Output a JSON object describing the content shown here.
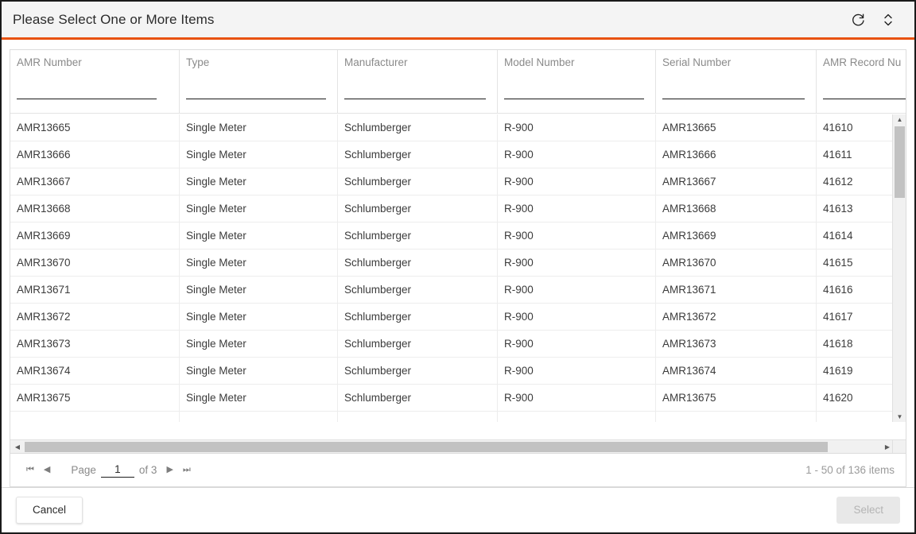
{
  "dialog": {
    "title": "Please Select One or More Items",
    "accent_color": "#e8520f",
    "refresh_icon": "refresh-icon",
    "expand_icon": "expand-collapse-icon"
  },
  "grid": {
    "columns": [
      {
        "label": "AMR Number",
        "filter_value": ""
      },
      {
        "label": "Type",
        "filter_value": ""
      },
      {
        "label": "Manufacturer",
        "filter_value": ""
      },
      {
        "label": "Model Number",
        "filter_value": ""
      },
      {
        "label": "Serial Number",
        "filter_value": ""
      },
      {
        "label": "AMR Record Nu",
        "filter_value": ""
      }
    ],
    "rows": [
      {
        "amr_number": "AMR13665",
        "type": "Single Meter",
        "manufacturer": "Schlumberger",
        "model_number": "R-900",
        "serial_number": "AMR13665",
        "amr_record_number": "41610"
      },
      {
        "amr_number": "AMR13666",
        "type": "Single Meter",
        "manufacturer": "Schlumberger",
        "model_number": "R-900",
        "serial_number": "AMR13666",
        "amr_record_number": "41611"
      },
      {
        "amr_number": "AMR13667",
        "type": "Single Meter",
        "manufacturer": "Schlumberger",
        "model_number": "R-900",
        "serial_number": "AMR13667",
        "amr_record_number": "41612"
      },
      {
        "amr_number": "AMR13668",
        "type": "Single Meter",
        "manufacturer": "Schlumberger",
        "model_number": "R-900",
        "serial_number": "AMR13668",
        "amr_record_number": "41613"
      },
      {
        "amr_number": "AMR13669",
        "type": "Single Meter",
        "manufacturer": "Schlumberger",
        "model_number": "R-900",
        "serial_number": "AMR13669",
        "amr_record_number": "41614"
      },
      {
        "amr_number": "AMR13670",
        "type": "Single Meter",
        "manufacturer": "Schlumberger",
        "model_number": "R-900",
        "serial_number": "AMR13670",
        "amr_record_number": "41615"
      },
      {
        "amr_number": "AMR13671",
        "type": "Single Meter",
        "manufacturer": "Schlumberger",
        "model_number": "R-900",
        "serial_number": "AMR13671",
        "amr_record_number": "41616"
      },
      {
        "amr_number": "AMR13672",
        "type": "Single Meter",
        "manufacturer": "Schlumberger",
        "model_number": "R-900",
        "serial_number": "AMR13672",
        "amr_record_number": "41617"
      },
      {
        "amr_number": "AMR13673",
        "type": "Single Meter",
        "manufacturer": "Schlumberger",
        "model_number": "R-900",
        "serial_number": "AMR13673",
        "amr_record_number": "41618"
      },
      {
        "amr_number": "AMR13674",
        "type": "Single Meter",
        "manufacturer": "Schlumberger",
        "model_number": "R-900",
        "serial_number": "AMR13674",
        "amr_record_number": "41619"
      },
      {
        "amr_number": "AMR13675",
        "type": "Single Meter",
        "manufacturer": "Schlumberger",
        "model_number": "R-900",
        "serial_number": "AMR13675",
        "amr_record_number": "41620"
      },
      {
        "amr_number": "",
        "type": "",
        "manufacturer": "",
        "model_number": "",
        "serial_number": "",
        "amr_record_number": ""
      }
    ]
  },
  "pager": {
    "first_icon": "first-page-icon",
    "prev_icon": "previous-page-icon",
    "next_icon": "next-page-icon",
    "last_icon": "last-page-icon",
    "page_label": "Page",
    "page_value": "1",
    "of_label": "of 3",
    "item_range": "1 - 50 of 136 items"
  },
  "footer": {
    "cancel_label": "Cancel",
    "select_label": "Select"
  }
}
